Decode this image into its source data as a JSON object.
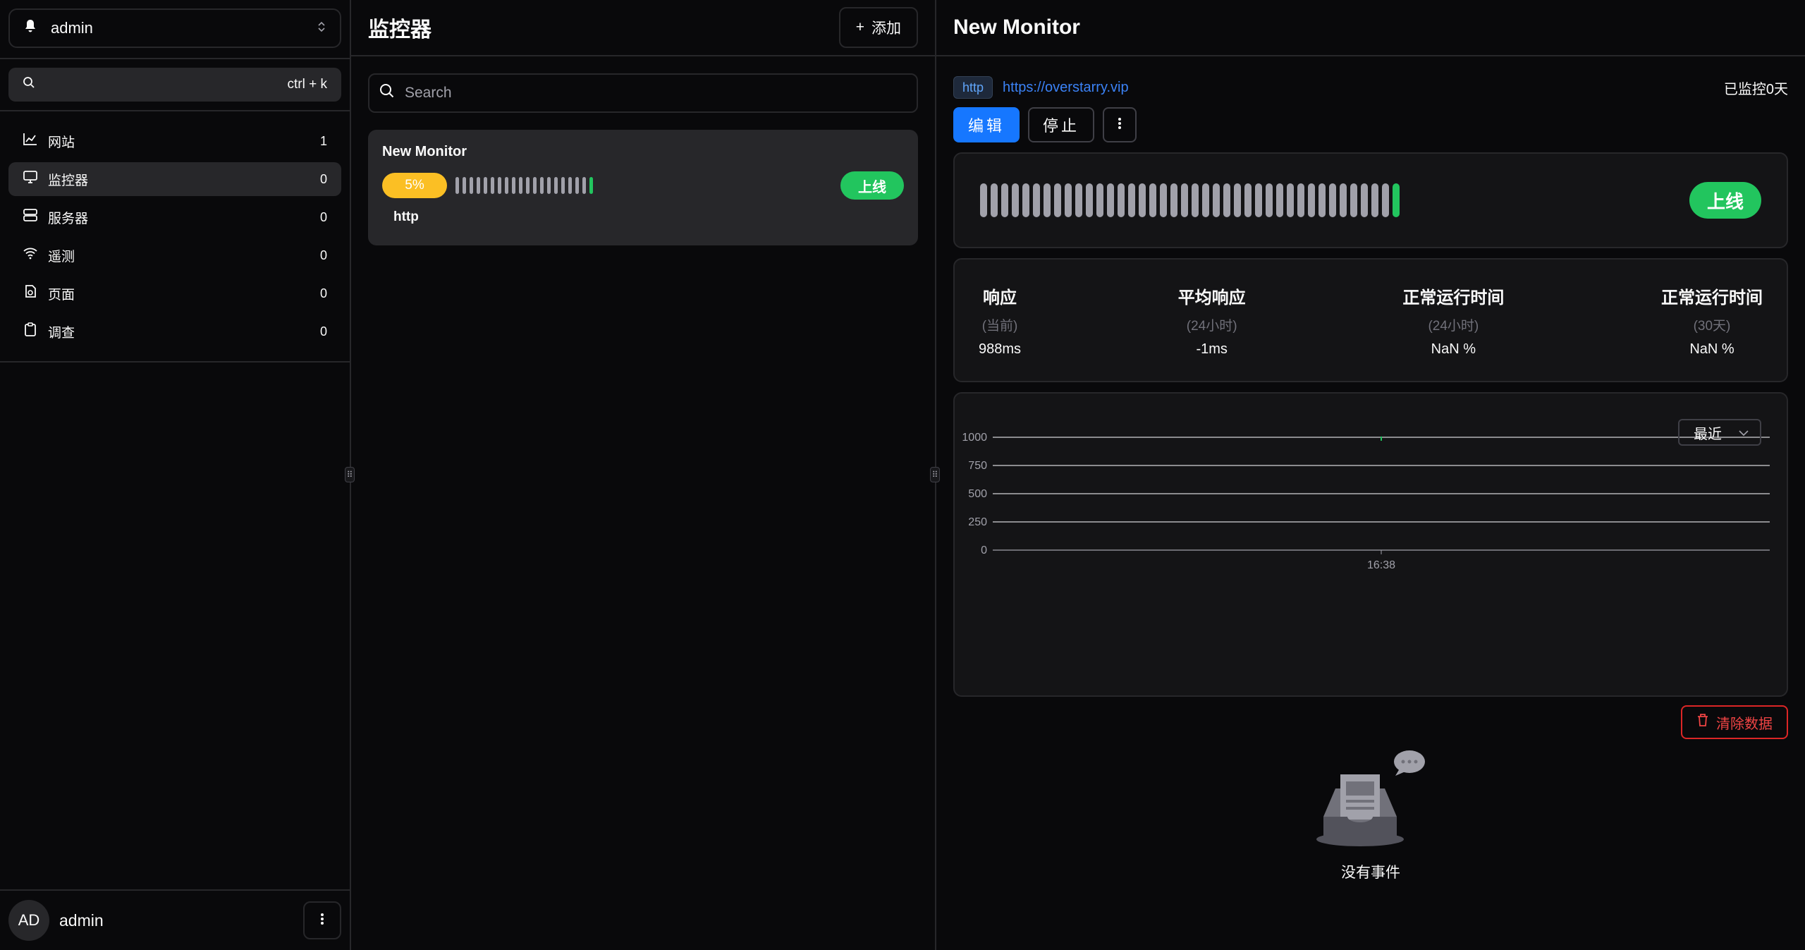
{
  "sidebar": {
    "workspace": "admin",
    "search": {
      "shortcut": "ctrl + k"
    },
    "nav": [
      {
        "label": "网站",
        "count": "1",
        "icon": "chart-icon"
      },
      {
        "label": "监控器",
        "count": "0",
        "icon": "monitor-icon",
        "active": true
      },
      {
        "label": "服务器",
        "count": "0",
        "icon": "server-icon"
      },
      {
        "label": "遥测",
        "count": "0",
        "icon": "wifi-icon"
      },
      {
        "label": "页面",
        "count": "0",
        "icon": "page-icon"
      },
      {
        "label": "调查",
        "count": "0",
        "icon": "clipboard-icon"
      }
    ],
    "user": {
      "initials": "AD",
      "name": "admin"
    }
  },
  "list": {
    "title": "监控器",
    "add_label": "添加",
    "search_placeholder": "Search",
    "monitor": {
      "name": "New Monitor",
      "percent": "5%",
      "status": "上线",
      "type": "http",
      "beats": {
        "down_count": 19,
        "up_count": 1
      }
    }
  },
  "detail": {
    "title": "New Monitor",
    "type": "http",
    "url": "https://overstarry.vip",
    "monitored_for": "已监控0天",
    "edit_label": "编辑",
    "stop_label": "停止",
    "status": "上线",
    "beats": {
      "down_count": 39,
      "up_count": 1
    },
    "stats": [
      {
        "title": "响应",
        "sub": "(当前)",
        "value": "988ms"
      },
      {
        "title": "平均响应",
        "sub": "(24小时)",
        "value": "-1ms"
      },
      {
        "title": "正常运行时间",
        "sub": "(24小时)",
        "value": "NaN %"
      },
      {
        "title": "正常运行时间",
        "sub": "(30天)",
        "value": "NaN %"
      }
    ],
    "range_select": "最近",
    "clear_label": "清除数据",
    "empty_text": "没有事件"
  },
  "chart_data": {
    "type": "line",
    "x": [
      "16:38"
    ],
    "series": [
      {
        "values": [
          988
        ]
      }
    ],
    "yticks": [
      0,
      250,
      500,
      750,
      1000
    ],
    "ylim": [
      0,
      1000
    ],
    "grid": true,
    "colors": {
      "line": "#22c55e"
    }
  },
  "colors": {
    "accent": "#1677ff",
    "up": "#22c55e",
    "pending": "#fbbf24",
    "danger": "#ef4444"
  }
}
